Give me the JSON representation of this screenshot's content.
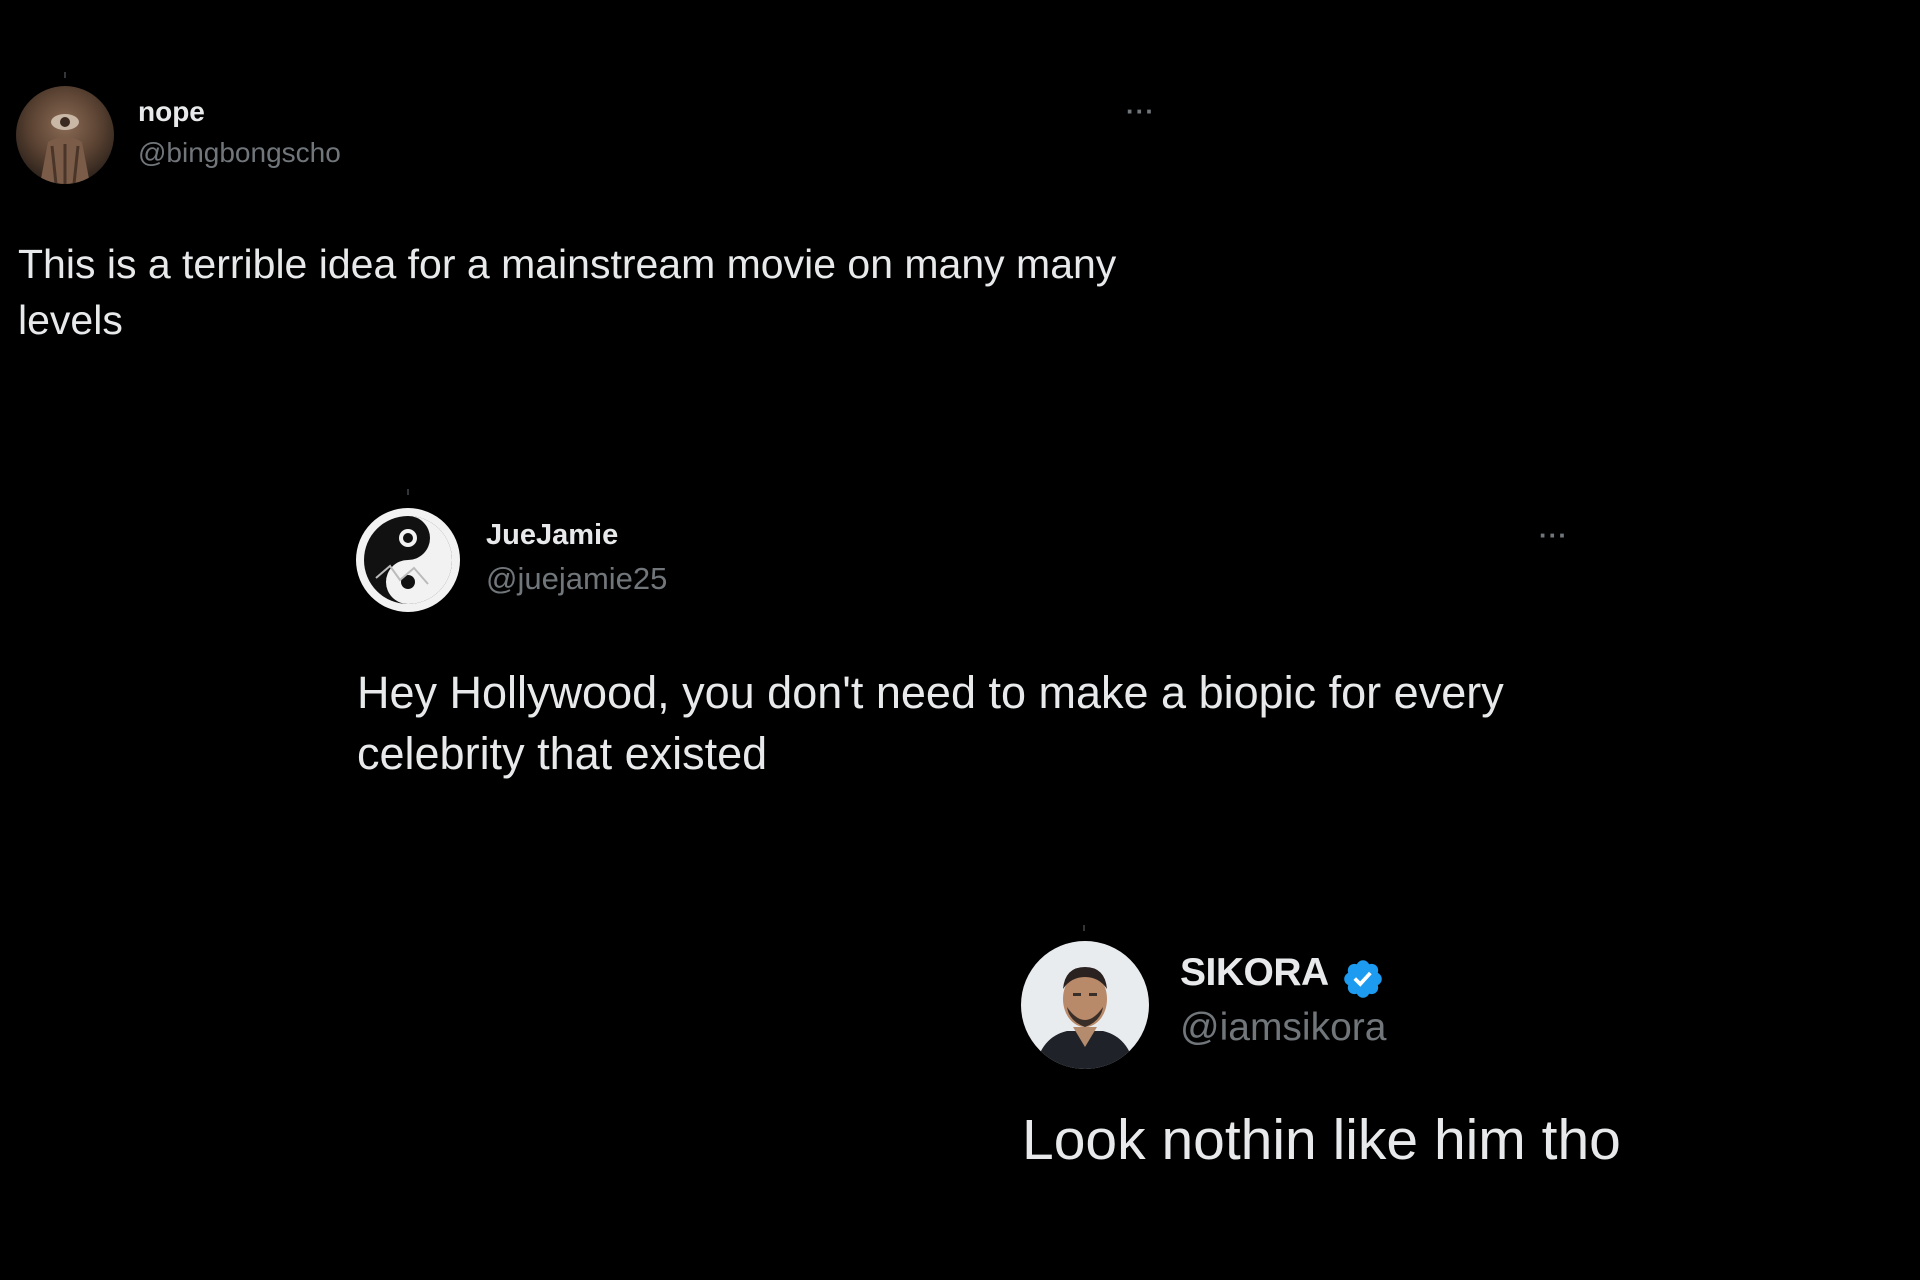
{
  "tweets": [
    {
      "display_name": "nope",
      "handle": "@bingbongscho",
      "text": "This is a terrible idea for a mainstream movie on many many levels",
      "more_label": "···"
    },
    {
      "display_name": "JueJamie",
      "handle": "@juejamie25",
      "text": "Hey Hollywood, you don't need to make a biopic for every celebrity that existed",
      "more_label": "···"
    },
    {
      "display_name": "SIKORA",
      "handle": "@iamsikora",
      "verified": true,
      "text": "Look nothin like him tho"
    }
  ],
  "colors": {
    "background": "#000000",
    "text_primary": "#e7e9ea",
    "text_secondary": "#71767b",
    "verified_badge": "#1d9bf0"
  },
  "icons": {
    "more": "more-horizontal-icon",
    "verified": "verified-badge-icon"
  }
}
